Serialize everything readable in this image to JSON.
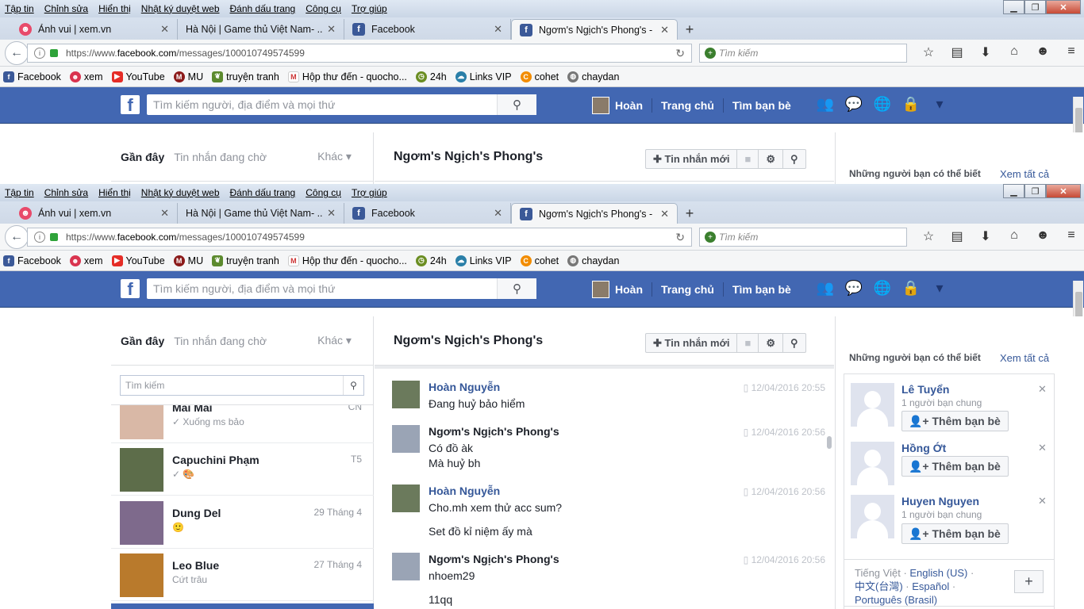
{
  "menu": [
    "Tập tin",
    "Chỉnh sửa",
    "Hiển thị",
    "Nhật ký duyệt web",
    "Đánh dấu trang",
    "Công cụ",
    "Trợ giúp"
  ],
  "tabs": [
    {
      "title": "Ảnh vui | xem.vn",
      "icon": "xemvn-icon"
    },
    {
      "title": "Hà Nội | Game thủ Việt Nam- ...",
      "icon": "none"
    },
    {
      "title": "Facebook",
      "icon": "facebook-icon"
    },
    {
      "title": "Ngơm's Ngịch's Phong's - ...",
      "icon": "facebook-icon"
    }
  ],
  "url": {
    "prefix": "https://www.",
    "host": "facebook.com",
    "path": "/messages/100010749574599"
  },
  "search_placeholder": "Tìm kiếm",
  "bookmarks": [
    {
      "label": "Facebook",
      "color": "#3b5998"
    },
    {
      "label": "xem",
      "color": "#d9344f"
    },
    {
      "label": "YouTube",
      "color": "#e52d27"
    },
    {
      "label": "MU",
      "color": "#8b1a1a"
    },
    {
      "label": "truyện tranh",
      "color": "#5c8a2e"
    },
    {
      "label": "Hộp thư đến - quocho...",
      "color": "#c33"
    },
    {
      "label": "24h",
      "color": "#6b8e23"
    },
    {
      "label": "Links VIP",
      "color": "#2a7fa8"
    },
    {
      "label": "cohet",
      "color": "#f28c00"
    },
    {
      "label": "chaydan",
      "color": "#777"
    }
  ],
  "fb": {
    "search_placeholder": "Tìm kiếm người, địa điểm và mọi thứ",
    "user": "Hoàn",
    "home": "Trang chủ",
    "find_friends": "Tìm bạn bè"
  },
  "messenger": {
    "tab_recent": "Gần đây",
    "tab_pending": "Tin nhắn đang chờ",
    "tab_other": "Khác",
    "conversation_title": "Ngơm's Ngịch's Phong's",
    "new_message": "Tin nhắn mới",
    "list_search": "Tìm kiếm",
    "threads": [
      {
        "name": "Mai Mai",
        "snippet": "✓ Xuống ms bảo",
        "date": "CN",
        "color": "#d9b8a6"
      },
      {
        "name": "Capuchini Phạm",
        "snippet": "✓ 🎨",
        "date": "T5",
        "color": "#5d6d4a"
      },
      {
        "name": "Dung Del",
        "snippet": "🙂",
        "date": "29 Tháng 4",
        "color": "#7e6a8c"
      },
      {
        "name": "Leo Blue",
        "snippet": "Cứt trâu",
        "date": "27 Tháng 4",
        "color": "#b97a2c"
      }
    ],
    "messages": [
      {
        "sender": "Hoàn Nguyễn",
        "lines": [
          "Đang huỷ bảo hiểm"
        ],
        "time": "12/04/2016 20:55",
        "blue": true
      },
      {
        "sender": "Ngơm's Ngịch's Phong's",
        "lines": [
          "Có đồ àk",
          "Mà huỷ bh"
        ],
        "time": "12/04/2016 20:56",
        "blue": false
      },
      {
        "sender": "Hoàn Nguyễn",
        "lines": [
          "Cho.mh xem thử acc sum?",
          "Set đồ kỉ niệm ấy mà"
        ],
        "time": "12/04/2016 20:56",
        "blue": true
      },
      {
        "sender": "Ngơm's Ngịch's Phong's",
        "lines": [
          "nhoem29",
          "11qq"
        ],
        "time": "12/04/2016 20:56",
        "blue": false
      }
    ]
  },
  "pymk": {
    "header": "Những người bạn có thể biết",
    "see_all": "Xem tất cả",
    "add_friend": "Thêm bạn bè",
    "people": [
      {
        "name": "Lê Tuyển",
        "mutual": "1 người bạn chung"
      },
      {
        "name": "Hồng Ớt",
        "mutual": ""
      },
      {
        "name": "Huyen Nguyen",
        "mutual": "1 người bạn chung"
      }
    ]
  },
  "languages": {
    "current": "Tiếng Việt",
    "options": [
      "English (US)",
      "中文(台灣)",
      "Español",
      "Português (Brasil)"
    ]
  }
}
